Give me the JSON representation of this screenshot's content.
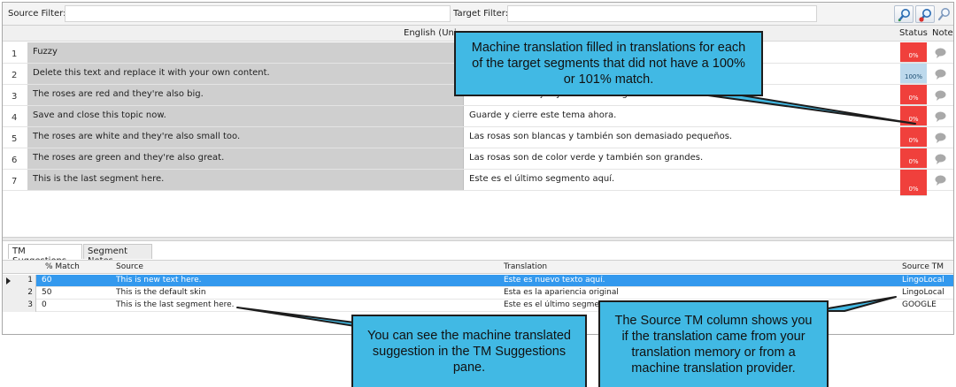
{
  "filters": {
    "source_label": "Source Filter:",
    "target_label": "Target Filter:"
  },
  "grid": {
    "source_column": "English (Uni",
    "status_column": "Status",
    "note_column": "Note"
  },
  "segments": [
    {
      "num": "1",
      "source": "Fuzzy",
      "target": "",
      "status": "0%"
    },
    {
      "num": "2",
      "source": "Delete this text and replace it with your own content.",
      "target": "",
      "status": "100%"
    },
    {
      "num": "3",
      "source": "The roses are red and they're also big.",
      "target": "Las rosas son rojas y también son grandes.",
      "status": "0%"
    },
    {
      "num": "4",
      "source": "Save and close this topic now.",
      "target": "Guarde y cierre este tema ahora.",
      "status": "0%"
    },
    {
      "num": "5",
      "source": "The roses are white and they're also small too.",
      "target": "Las rosas son blancas y también son demasiado pequeños.",
      "status": "0%"
    },
    {
      "num": "6",
      "source": "The roses are green and they're also great.",
      "target": "Las rosas son de color verde y también son grandes.",
      "status": "0%"
    },
    {
      "num": "7",
      "source": "This is the last segment here.",
      "target": "Este es el último segmento aquí.",
      "status": "0%"
    }
  ],
  "tabs": {
    "tm_suggestions": "TM Suggestions",
    "segment_notes": "Segment Notes"
  },
  "tm": {
    "headers": {
      "match": "% Match",
      "source": "Source",
      "translation": "Translation",
      "source_tm": "Source TM"
    },
    "rows": [
      {
        "num": "1",
        "match": "60",
        "source": "This is new text here.",
        "translation": "Este es nuevo texto aquí.",
        "source_tm": "LingoLocal"
      },
      {
        "num": "2",
        "match": "50",
        "source": "This is the default skin",
        "translation": "Esta es la apariencia original",
        "source_tm": "LingoLocal"
      },
      {
        "num": "3",
        "match": "0",
        "source": "This is the last segment here.",
        "translation": "Este es el último segmento aquí.",
        "source_tm": "GOOGLE"
      }
    ]
  },
  "callouts": {
    "machine_translation": "Machine translation filled in translations for each of the target segments that did not have a 100% or 101% match.",
    "tm_pane": "You can see the machine translated suggestion in the TM Suggestions pane.",
    "source_tm": "The Source TM column shows you if the translation came from your translation memory or from a machine translation provider."
  },
  "colors": {
    "callout": "#41b9e4",
    "status_untranslated": "#f0403c",
    "status_full_match": "#bdd9ec",
    "selected_row": "#3399ee",
    "source_cell": "#cfcfcf"
  },
  "icons": [
    "find-icon",
    "find-next-icon",
    "clear-filter-icon",
    "note-bubble-icon",
    "row-selector-arrow-icon"
  ]
}
